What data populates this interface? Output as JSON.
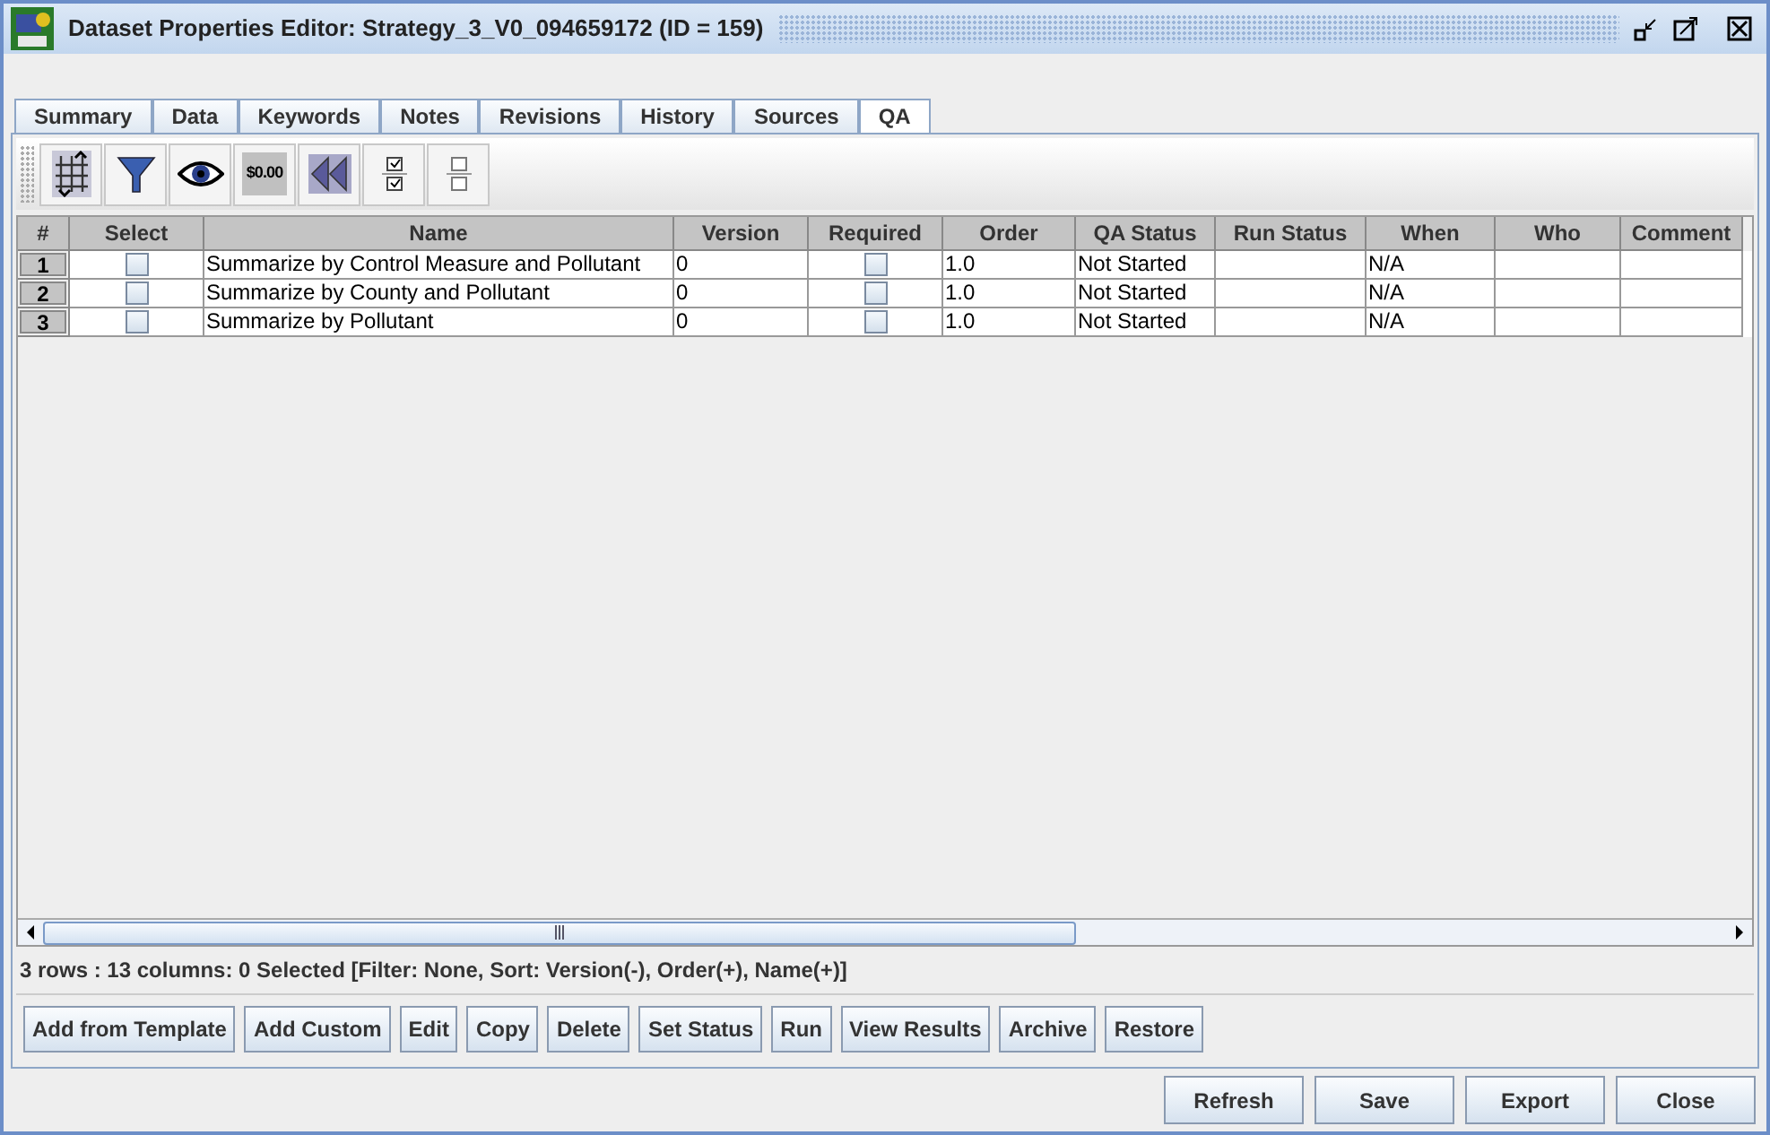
{
  "window": {
    "title": "Dataset Properties Editor: Strategy_3_V0_094659172 (ID = 159)"
  },
  "tabs": [
    {
      "label": "Summary",
      "selected": false
    },
    {
      "label": "Data",
      "selected": false
    },
    {
      "label": "Keywords",
      "selected": false
    },
    {
      "label": "Notes",
      "selected": false
    },
    {
      "label": "Revisions",
      "selected": false
    },
    {
      "label": "History",
      "selected": false
    },
    {
      "label": "Sources",
      "selected": false
    },
    {
      "label": "QA",
      "selected": true
    }
  ],
  "toolbar": [
    {
      "kind": "sort"
    },
    {
      "kind": "filter"
    },
    {
      "kind": "view"
    },
    {
      "kind": "format",
      "label": "$0.00"
    },
    {
      "kind": "reset"
    },
    {
      "kind": "select-all"
    },
    {
      "kind": "clear-all"
    }
  ],
  "table": {
    "columns": [
      "#",
      "Select",
      "Name",
      "Version",
      "Required",
      "Order",
      "QA Status",
      "Run Status",
      "When",
      "Who",
      "Comment"
    ],
    "rows": [
      {
        "number": "1",
        "selected": false,
        "name": "Summarize by Control Measure and Pollutant",
        "version": "0",
        "required": false,
        "order": "1.0",
        "qa_status": "Not Started",
        "when": "N/A"
      },
      {
        "number": "2",
        "selected": false,
        "name": "Summarize by County and Pollutant",
        "version": "0",
        "required": false,
        "order": "1.0",
        "qa_status": "Not Started",
        "when": "N/A"
      },
      {
        "number": "3",
        "selected": false,
        "name": "Summarize by Pollutant",
        "version": "0",
        "required": false,
        "order": "1.0",
        "qa_status": "Not Started",
        "when": "N/A"
      }
    ]
  },
  "status_bar": "3 rows : 13 columns: 0 Selected [Filter: None, Sort: Version(-), Order(+), Name(+)]",
  "qa_buttons": [
    "Add from Template",
    "Add Custom",
    "Edit",
    "Copy",
    "Delete",
    "Set Status",
    "Run",
    "View Results",
    "Archive",
    "Restore"
  ],
  "dialog_buttons": [
    "Refresh",
    "Save",
    "Export",
    "Close"
  ]
}
